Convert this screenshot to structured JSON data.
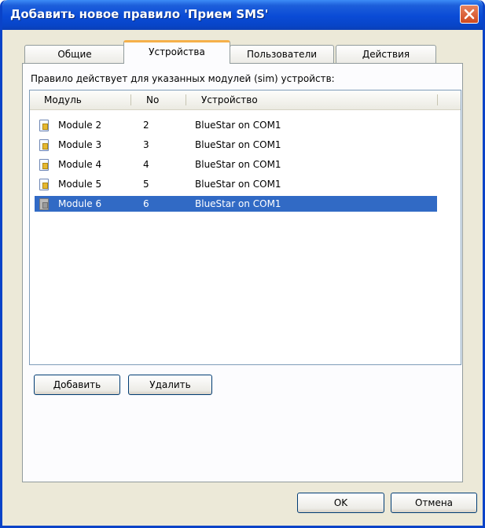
{
  "window": {
    "title": "Добавить новое правило 'Прием SMS'"
  },
  "tabs": [
    {
      "label": "Общие"
    },
    {
      "label": "Устройства"
    },
    {
      "label": "Пользователи"
    },
    {
      "label": "Действия"
    }
  ],
  "active_tab": "Устройства",
  "panel": {
    "description": "Правило действует для указанных модулей (sim) устройств:"
  },
  "list": {
    "columns": [
      "Модуль",
      "No",
      "Устройство"
    ],
    "rows": [
      {
        "module": "Module 2",
        "no": "2",
        "device": "BlueStar on COM1",
        "icon": "sim-card-icon",
        "selected": false
      },
      {
        "module": "Module 3",
        "no": "3",
        "device": "BlueStar on COM1",
        "icon": "sim-card-icon",
        "selected": false
      },
      {
        "module": "Module 4",
        "no": "4",
        "device": "BlueStar on COM1",
        "icon": "sim-card-icon",
        "selected": false
      },
      {
        "module": "Module 5",
        "no": "5",
        "device": "BlueStar on COM1",
        "icon": "sim-card-icon",
        "selected": false
      },
      {
        "module": "Module 6",
        "no": "6",
        "device": "BlueStar on COM1",
        "icon": "sim-card-gray-icon",
        "selected": true
      }
    ]
  },
  "buttons": {
    "add": "Добавить",
    "remove": "Удалить",
    "ok": "OK",
    "cancel": "Отмена"
  },
  "colors": {
    "titlebar": "#0a4bd6",
    "selection": "#316ac5",
    "active_tab_accent": "#f5b04b",
    "close_button": "#d0491e"
  }
}
